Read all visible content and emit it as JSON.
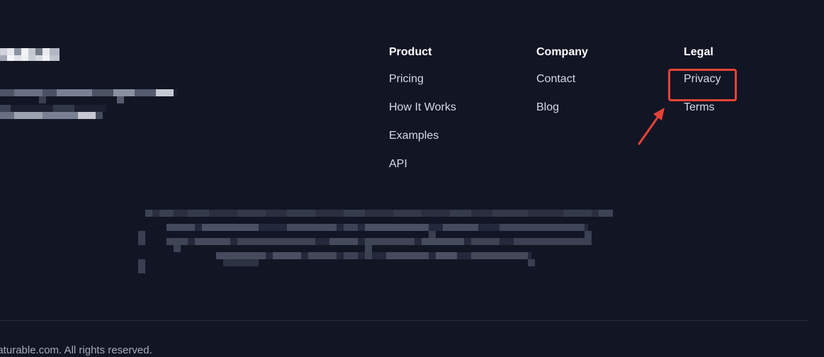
{
  "columns": {
    "product": {
      "title": "Product",
      "links": [
        "Pricing",
        "How It Works",
        "Examples",
        "API"
      ]
    },
    "company": {
      "title": "Company",
      "links": [
        "Contact",
        "Blog"
      ]
    },
    "legal": {
      "title": "Legal",
      "links": [
        "Privacy",
        "Terms"
      ]
    }
  },
  "copyright": "eaturable.com. All rights reserved.",
  "colors": {
    "background": "#121524",
    "heading": "#ffffff",
    "link": "#d7dae2",
    "annotation": "#e64336",
    "divider": "#2b3041"
  },
  "annotations": {
    "highlight": "Privacy",
    "arrow": "arrow-icon"
  }
}
